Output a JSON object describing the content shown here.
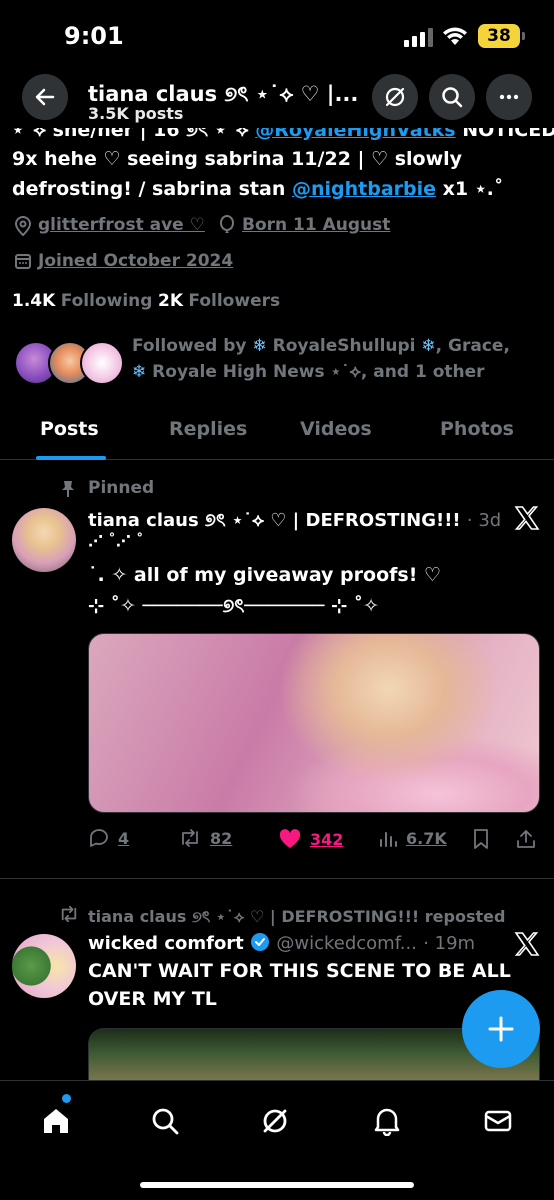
{
  "status_bar": {
    "time": "9:01",
    "battery": "38"
  },
  "header": {
    "display_name": "tiana claus ୭ৎ ⋆˙⟡ ♡ |...",
    "posts_count": "3.5K posts"
  },
  "bio": {
    "line0_prefix": "⋆˙⟡ she/her | 16 ୭ৎ ⋆˙⟡",
    "line0_link": "@RoyaleHighVatks",
    "line0_suffix": "NOTICED",
    "line1": "9x hehe ♡ seeing sabrina 11/22 | ♡ slowly",
    "line2_prefix": "defrosting! / sabrina stan",
    "line2_link": "@nightbarbie",
    "line2_suffix": "x1 ⋆.˚"
  },
  "profile_meta": {
    "location": "glitterfrost ave ♡",
    "birthday": "Born 11 August",
    "joined": "Joined October 2024"
  },
  "follow_stats": {
    "following_count": "1.4K",
    "following_label": "Following",
    "followers_count": "2K",
    "followers_label": "Followers"
  },
  "followed_by": {
    "line1_prefix": "Followed by",
    "line1_name": "RoyaleShullupi",
    "line1_suffix": ", Grace,",
    "line2_name": "Royale High News ⋆˙⟡",
    "line2_suffix": ", and 1 other"
  },
  "tabs": [
    {
      "label": "Posts",
      "active": true
    },
    {
      "label": "Replies",
      "active": false
    },
    {
      "label": "Videos",
      "active": false
    },
    {
      "label": "Photos",
      "active": false
    }
  ],
  "pinned_post": {
    "pinned_label": "Pinned",
    "author": "tiana claus ୭ৎ ⋆˙⟡ ♡ | DEFROSTING!!!",
    "time": "· 3d",
    "text_line1": "⋰ ˚⋰ ˚",
    "text_line2": "˙. ✧ all of my giveaway proofs! ♡",
    "text_line3": "⊹ ˚✧ ───────୭ৎ─────── ⊹ ˚✧",
    "stats": {
      "replies": "4",
      "reposts": "82",
      "likes": "342",
      "views": "6.7K"
    }
  },
  "repost": {
    "reposted_by": "tiana claus ୭ৎ ⋆˙⟡ ♡ | DEFROSTING!!! reposted",
    "author": "wicked comfort",
    "handle": "@wickedcomf...",
    "time": "· 19m",
    "text_line1": "CAN'T WAIT FOR THIS SCENE TO BE ALL",
    "text_line2": "OVER MY TL"
  },
  "icons": {
    "back": "back-arrow-icon",
    "grok": "grok-icon",
    "search": "search-icon",
    "more": "more-icon",
    "location": "location-pin-icon",
    "birthday": "balloon-icon",
    "calendar": "calendar-icon",
    "pin": "pin-icon",
    "x": "x-logo-icon",
    "reply": "reply-icon",
    "repost": "repost-icon",
    "like": "heart-icon",
    "views": "views-icon",
    "bookmark": "bookmark-icon",
    "share": "share-icon",
    "verified": "verified-badge-icon",
    "compose": "plus-icon",
    "home": "home-icon",
    "nav_search": "search-icon",
    "nav_grok": "grok-icon",
    "notifications": "bell-icon",
    "messages": "mail-icon"
  },
  "colors": {
    "accent": "#1d9bf0",
    "like": "#f91880",
    "muted": "#71767b",
    "battery": "#f5d33b",
    "background": "#000000"
  }
}
